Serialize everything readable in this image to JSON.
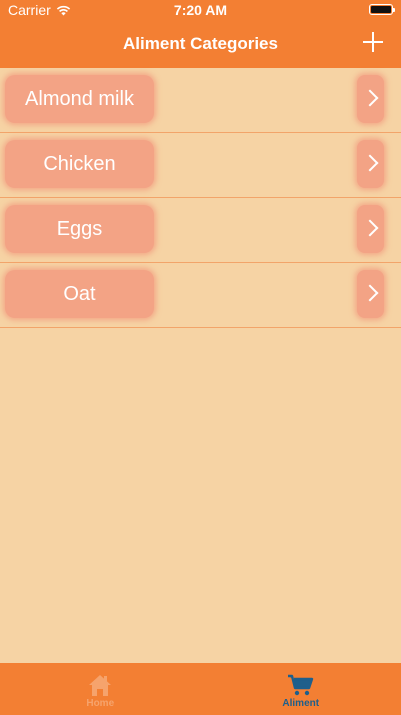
{
  "status": {
    "carrier": "Carrier",
    "time": "7:20 AM"
  },
  "nav": {
    "title": "Aliment Categories",
    "add_icon": "plus-icon"
  },
  "categories": [
    {
      "label": "Almond milk"
    },
    {
      "label": "Chicken"
    },
    {
      "label": "Eggs"
    },
    {
      "label": "Oat"
    }
  ],
  "tabs": [
    {
      "label": "Home",
      "icon": "house-icon",
      "selected": false
    },
    {
      "label": "Aliment",
      "icon": "cart-icon",
      "selected": true
    }
  ],
  "colors": {
    "bar": "#f37f33",
    "background": "#f6d3a4",
    "pill": "#f3a385",
    "selected_tab": "#1f5f8b"
  }
}
